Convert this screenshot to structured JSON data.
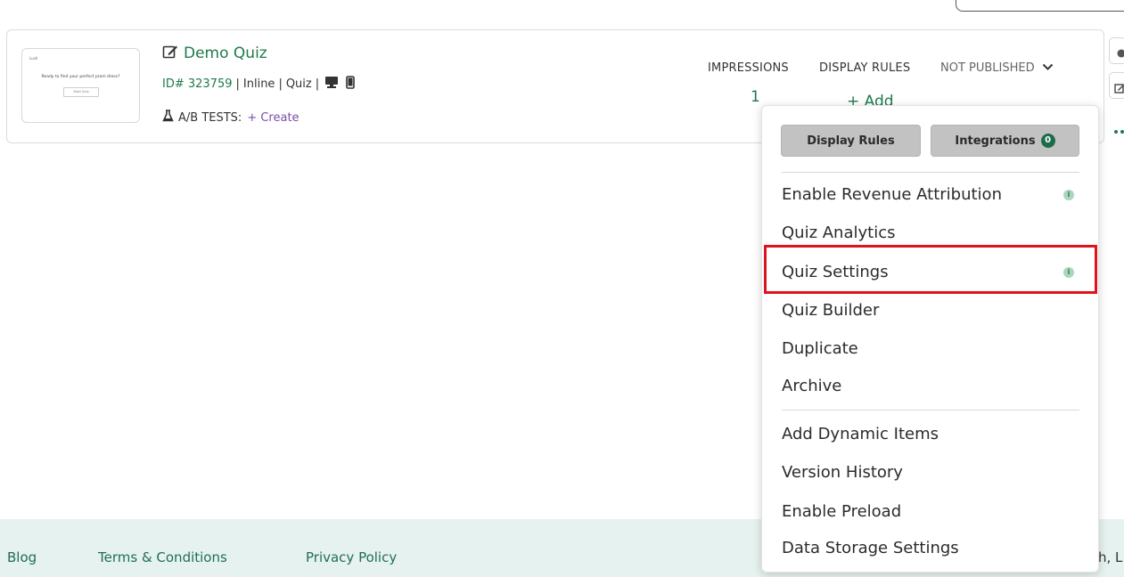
{
  "quiz": {
    "title": "Demo Quiz",
    "id_label": "ID# 323759",
    "type": "Inline",
    "category": "Quiz",
    "ab_label": "A/B TESTS:",
    "ab_create": "+ Create",
    "thumbnail": {
      "logo": "Lush",
      "question": "Ready to find your perfect prom dress?",
      "button": "Start Quiz"
    }
  },
  "columns": {
    "impressions_label": "IMPRESSIONS",
    "impressions_value": "1",
    "display_rules_label": "DISPLAY RULES",
    "display_rules_add": "+ Add",
    "status": "NOT PUBLISHED"
  },
  "menu": {
    "display_rules_button": "Display Rules",
    "integrations_button": "Integrations",
    "integrations_count": "0",
    "items": [
      "Enable Revenue Attribution",
      "Quiz Analytics",
      "Quiz Settings",
      "Quiz Builder",
      "Duplicate",
      "Archive",
      "Add Dynamic Items",
      "Version History",
      "Enable Preload",
      "Data Storage Settings"
    ],
    "info_glyph": "i"
  },
  "footer": {
    "blog": "Blog",
    "terms": "Terms & Conditions",
    "privacy": "Privacy Policy",
    "copyright_partial": "h, L"
  },
  "colors": {
    "brand_green": "#1e7a4b",
    "highlight_red": "#e0121d",
    "footer_bg": "#e6f2ef"
  }
}
